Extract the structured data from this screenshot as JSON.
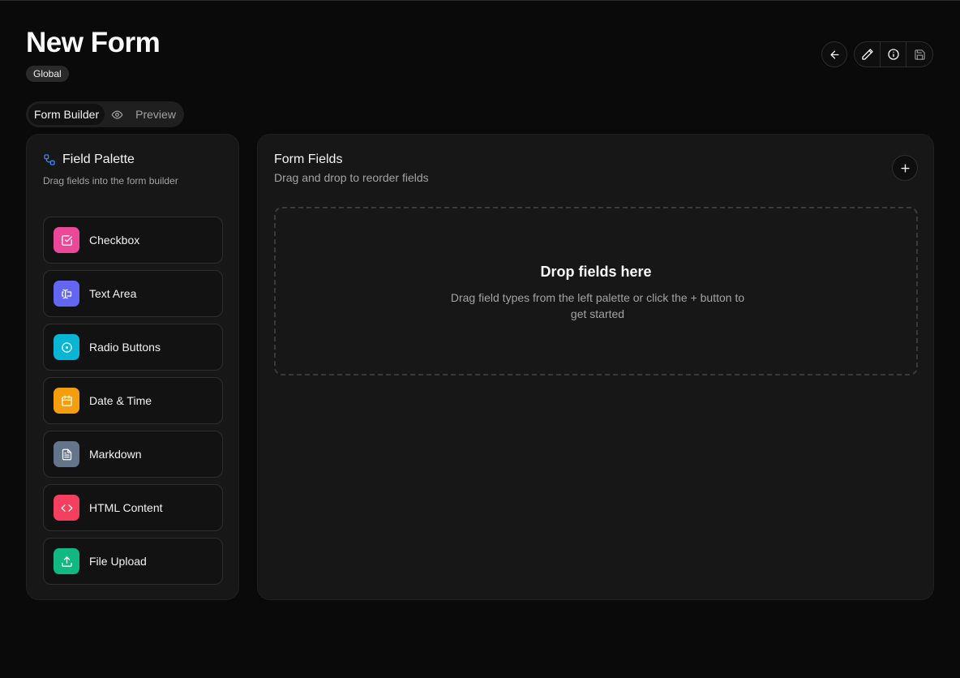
{
  "header": {
    "title": "New Form",
    "badge": "Global",
    "actions": [
      {
        "name": "back",
        "icon": "arrow-left-icon"
      },
      {
        "name": "edit",
        "icon": "pencil-icon"
      },
      {
        "name": "info",
        "icon": "info-icon"
      },
      {
        "name": "save",
        "icon": "save-icon"
      }
    ]
  },
  "tabs": [
    {
      "label": "Form Builder",
      "active": true
    },
    {
      "label": "Preview",
      "icon": "eye-icon",
      "active": false
    }
  ],
  "palette": {
    "title": "Field Palette",
    "subtitle": "Drag fields into the form builder",
    "items": [
      {
        "label": "Checkbox",
        "icon": "checkbox-icon",
        "color": "#ec4899"
      },
      {
        "label": "Text Area",
        "icon": "text-area-icon",
        "color": "#6366f1"
      },
      {
        "label": "Radio Buttons",
        "icon": "radio-icon",
        "color": "#06b6d4"
      },
      {
        "label": "Date & Time",
        "icon": "calendar-icon",
        "color": "#f59e0b"
      },
      {
        "label": "Markdown",
        "icon": "document-icon",
        "color": "#64748b"
      },
      {
        "label": "HTML Content",
        "icon": "code-icon",
        "color": "#f43f5e"
      },
      {
        "label": "File Upload",
        "icon": "upload-icon",
        "color": "#10b981"
      }
    ]
  },
  "builder": {
    "title": "Form Fields",
    "subtitle": "Drag and drop to reorder fields",
    "empty_title": "Drop fields here",
    "empty_subtitle": "Drag field types from the left palette or click the + button to get started"
  },
  "colors": {
    "background": "#0a0a0a",
    "card": "#171717",
    "accent_icon": "#3b82f6"
  }
}
